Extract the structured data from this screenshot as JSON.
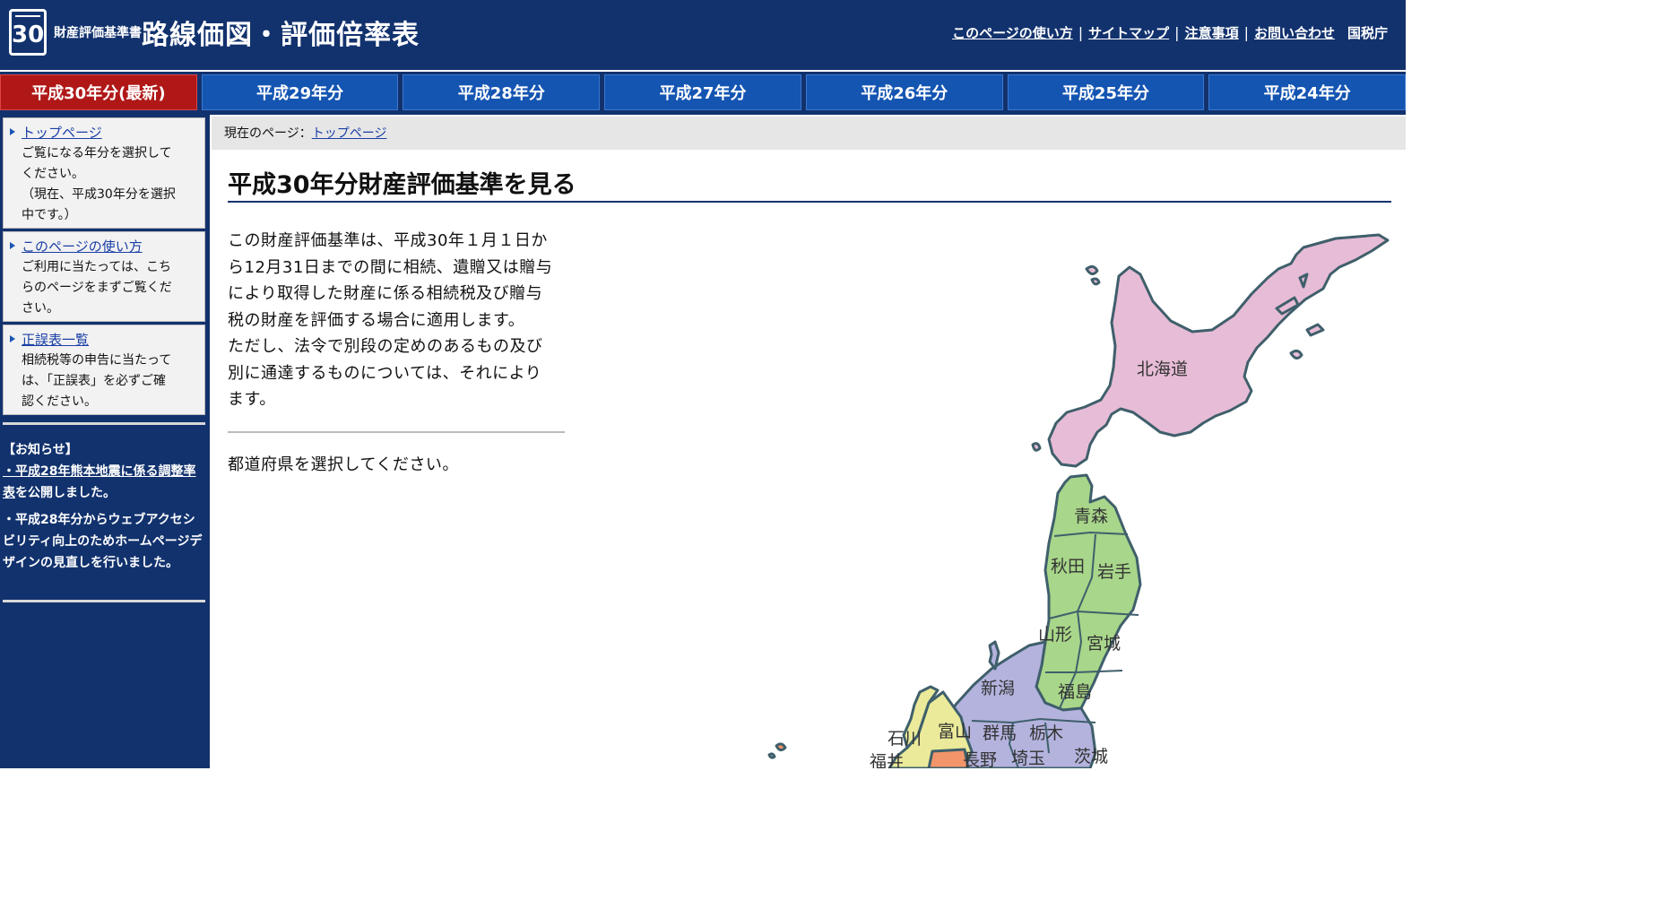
{
  "header": {
    "logo_number": "30",
    "title_small": "財産評価基準書",
    "title_big": "路線価図・評価倍率表",
    "util_links": [
      "このページの使い方",
      "サイトマップ",
      "注意事項",
      "お問い合わせ"
    ],
    "agency": "国税庁"
  },
  "tabs": [
    {
      "label": "平成30年分(最新)",
      "active": true
    },
    {
      "label": "平成29年分",
      "active": false
    },
    {
      "label": "平成28年分",
      "active": false
    },
    {
      "label": "平成27年分",
      "active": false
    },
    {
      "label": "平成26年分",
      "active": false
    },
    {
      "label": "平成25年分",
      "active": false
    },
    {
      "label": "平成24年分",
      "active": false
    }
  ],
  "sidebar": {
    "boxes": [
      {
        "link": "トップページ",
        "text_lines": [
          "ご覧になる年分を選択して",
          "ください。",
          "（現在、平成30年分を選択",
          "中です。）"
        ]
      },
      {
        "link": "このページの使い方",
        "text_lines": [
          "ご利用に当たっては、こち",
          "らのページをまずご覧くだ",
          "さい。"
        ]
      },
      {
        "link": "正誤表一覧",
        "text_lines": [
          "相続税等の申告に当たって",
          "は、「正誤表」を必ずご確",
          "認ください。"
        ]
      }
    ],
    "notice": {
      "heading": "【お知らせ】",
      "item1_link": "・平成28年熊本地震に係る調整率表",
      "item1_rest": "を公開しました。",
      "item2": "・平成28年分からウェブアクセシビリティ向上のためホームページデザインの見直しを行いました。"
    }
  },
  "breadcrumb": {
    "prefix": "現在のページ：",
    "current": "トップページ"
  },
  "main": {
    "title": "平成30年分財産評価基準を見る",
    "intro_lines": [
      "この財産評価基準は、平成30年１月１日か",
      "ら12月31日までの間に相続、遺贈又は贈与",
      "により取得した財産に係る相続税及び贈与",
      "税の財産を評価する場合に適用します。",
      "ただし、法令で別段の定めのあるもの及び",
      "別に通達するものについては、それにより",
      "ます。"
    ],
    "select_prompt": "都道府県を選択してください。"
  },
  "map": {
    "colors": {
      "hokkaido": "#e7bcd6",
      "tohoku": "#a8d68a",
      "kanto": "#b3b3de",
      "chubu_yellow": "#eaea9a",
      "orange": "#f2956a",
      "stroke": "#3f5f6b"
    },
    "labels": [
      "北海道",
      "青森",
      "秋田",
      "岩手",
      "山形",
      "宮城",
      "新潟",
      "福島",
      "石川",
      "富山",
      "群馬",
      "栃木",
      "福井",
      "長野",
      "埼玉",
      "茨城"
    ]
  }
}
